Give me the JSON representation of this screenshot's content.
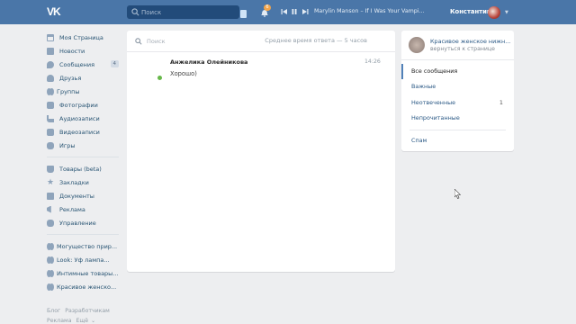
{
  "header": {
    "logo": "VK",
    "search_placeholder": "Поиск",
    "notifications_count": "6",
    "track": "Marylin Manson – If I Was Your Vampi...",
    "username": "Константин"
  },
  "colors": {
    "header": "#4a76a8",
    "link": "#2a5885",
    "online": "#67b84a",
    "badge": "#f3a54b"
  },
  "sidebar": {
    "items": [
      {
        "label": "Моя Страница",
        "icon": "home-icon"
      },
      {
        "label": "Новости",
        "icon": "news-icon"
      },
      {
        "label": "Сообщения",
        "icon": "messages-icon",
        "count": "4"
      },
      {
        "label": "Друзья",
        "icon": "friends-icon"
      },
      {
        "label": "Группы",
        "icon": "groups-icon"
      },
      {
        "label": "Фотографии",
        "icon": "photos-icon"
      },
      {
        "label": "Аудиозаписи",
        "icon": "audio-icon"
      },
      {
        "label": "Видеозаписи",
        "icon": "video-icon"
      },
      {
        "label": "Игры",
        "icon": "games-icon"
      }
    ],
    "items2": [
      {
        "label": "Товары (beta)",
        "icon": "shop-icon"
      },
      {
        "label": "Закладки",
        "icon": "bookmarks-icon"
      },
      {
        "label": "Документы",
        "icon": "documents-icon"
      },
      {
        "label": "Реклама",
        "icon": "ads-icon"
      },
      {
        "label": "Управление",
        "icon": "manage-icon"
      }
    ],
    "groups": [
      {
        "label": "Могущество прир..."
      },
      {
        "label": "Look: Уф лампа..."
      },
      {
        "label": "Интимные товары..."
      },
      {
        "label": "Красивое женско..."
      }
    ],
    "footer": [
      "Блог",
      "Разработчикам",
      "Реклама",
      "Ещё"
    ]
  },
  "messages": {
    "search_placeholder": "Поиск",
    "response_time": "Среднее время ответа — 5 часов",
    "dialogs": [
      {
        "name": "Анжелика Олейникова",
        "time": "14:26",
        "text": "Хорошо)"
      }
    ]
  },
  "community": {
    "title": "Красивое женское нижн...",
    "back": "вернуться к странице",
    "filters": [
      {
        "label": "Все сообщения",
        "active": true
      },
      {
        "label": "Важные"
      },
      {
        "label": "Неотвеченные",
        "count": "1"
      },
      {
        "label": "Непрочитанные"
      },
      {
        "label": "Спам"
      }
    ]
  }
}
